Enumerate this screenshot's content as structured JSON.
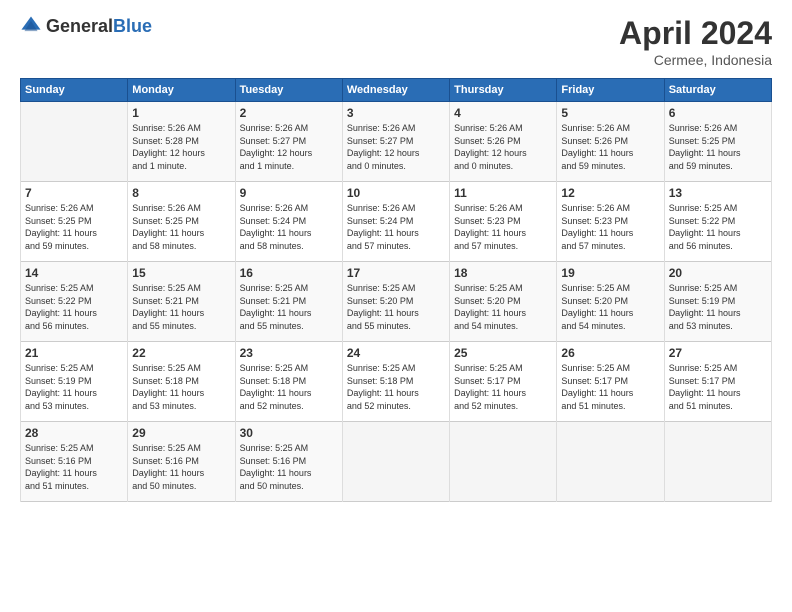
{
  "header": {
    "logo_general": "General",
    "logo_blue": "Blue",
    "month_year": "April 2024",
    "location": "Cermee, Indonesia"
  },
  "calendar": {
    "days_of_week": [
      "Sunday",
      "Monday",
      "Tuesday",
      "Wednesday",
      "Thursday",
      "Friday",
      "Saturday"
    ],
    "weeks": [
      [
        {
          "day": "",
          "info": ""
        },
        {
          "day": "1",
          "info": "Sunrise: 5:26 AM\nSunset: 5:28 PM\nDaylight: 12 hours\nand 1 minute."
        },
        {
          "day": "2",
          "info": "Sunrise: 5:26 AM\nSunset: 5:27 PM\nDaylight: 12 hours\nand 1 minute."
        },
        {
          "day": "3",
          "info": "Sunrise: 5:26 AM\nSunset: 5:27 PM\nDaylight: 12 hours\nand 0 minutes."
        },
        {
          "day": "4",
          "info": "Sunrise: 5:26 AM\nSunset: 5:26 PM\nDaylight: 12 hours\nand 0 minutes."
        },
        {
          "day": "5",
          "info": "Sunrise: 5:26 AM\nSunset: 5:26 PM\nDaylight: 11 hours\nand 59 minutes."
        },
        {
          "day": "6",
          "info": "Sunrise: 5:26 AM\nSunset: 5:25 PM\nDaylight: 11 hours\nand 59 minutes."
        }
      ],
      [
        {
          "day": "7",
          "info": "Sunrise: 5:26 AM\nSunset: 5:25 PM\nDaylight: 11 hours\nand 59 minutes."
        },
        {
          "day": "8",
          "info": "Sunrise: 5:26 AM\nSunset: 5:25 PM\nDaylight: 11 hours\nand 58 minutes."
        },
        {
          "day": "9",
          "info": "Sunrise: 5:26 AM\nSunset: 5:24 PM\nDaylight: 11 hours\nand 58 minutes."
        },
        {
          "day": "10",
          "info": "Sunrise: 5:26 AM\nSunset: 5:24 PM\nDaylight: 11 hours\nand 57 minutes."
        },
        {
          "day": "11",
          "info": "Sunrise: 5:26 AM\nSunset: 5:23 PM\nDaylight: 11 hours\nand 57 minutes."
        },
        {
          "day": "12",
          "info": "Sunrise: 5:26 AM\nSunset: 5:23 PM\nDaylight: 11 hours\nand 57 minutes."
        },
        {
          "day": "13",
          "info": "Sunrise: 5:25 AM\nSunset: 5:22 PM\nDaylight: 11 hours\nand 56 minutes."
        }
      ],
      [
        {
          "day": "14",
          "info": "Sunrise: 5:25 AM\nSunset: 5:22 PM\nDaylight: 11 hours\nand 56 minutes."
        },
        {
          "day": "15",
          "info": "Sunrise: 5:25 AM\nSunset: 5:21 PM\nDaylight: 11 hours\nand 55 minutes."
        },
        {
          "day": "16",
          "info": "Sunrise: 5:25 AM\nSunset: 5:21 PM\nDaylight: 11 hours\nand 55 minutes."
        },
        {
          "day": "17",
          "info": "Sunrise: 5:25 AM\nSunset: 5:20 PM\nDaylight: 11 hours\nand 55 minutes."
        },
        {
          "day": "18",
          "info": "Sunrise: 5:25 AM\nSunset: 5:20 PM\nDaylight: 11 hours\nand 54 minutes."
        },
        {
          "day": "19",
          "info": "Sunrise: 5:25 AM\nSunset: 5:20 PM\nDaylight: 11 hours\nand 54 minutes."
        },
        {
          "day": "20",
          "info": "Sunrise: 5:25 AM\nSunset: 5:19 PM\nDaylight: 11 hours\nand 53 minutes."
        }
      ],
      [
        {
          "day": "21",
          "info": "Sunrise: 5:25 AM\nSunset: 5:19 PM\nDaylight: 11 hours\nand 53 minutes."
        },
        {
          "day": "22",
          "info": "Sunrise: 5:25 AM\nSunset: 5:18 PM\nDaylight: 11 hours\nand 53 minutes."
        },
        {
          "day": "23",
          "info": "Sunrise: 5:25 AM\nSunset: 5:18 PM\nDaylight: 11 hours\nand 52 minutes."
        },
        {
          "day": "24",
          "info": "Sunrise: 5:25 AM\nSunset: 5:18 PM\nDaylight: 11 hours\nand 52 minutes."
        },
        {
          "day": "25",
          "info": "Sunrise: 5:25 AM\nSunset: 5:17 PM\nDaylight: 11 hours\nand 52 minutes."
        },
        {
          "day": "26",
          "info": "Sunrise: 5:25 AM\nSunset: 5:17 PM\nDaylight: 11 hours\nand 51 minutes."
        },
        {
          "day": "27",
          "info": "Sunrise: 5:25 AM\nSunset: 5:17 PM\nDaylight: 11 hours\nand 51 minutes."
        }
      ],
      [
        {
          "day": "28",
          "info": "Sunrise: 5:25 AM\nSunset: 5:16 PM\nDaylight: 11 hours\nand 51 minutes."
        },
        {
          "day": "29",
          "info": "Sunrise: 5:25 AM\nSunset: 5:16 PM\nDaylight: 11 hours\nand 50 minutes."
        },
        {
          "day": "30",
          "info": "Sunrise: 5:25 AM\nSunset: 5:16 PM\nDaylight: 11 hours\nand 50 minutes."
        },
        {
          "day": "",
          "info": ""
        },
        {
          "day": "",
          "info": ""
        },
        {
          "day": "",
          "info": ""
        },
        {
          "day": "",
          "info": ""
        }
      ]
    ]
  }
}
